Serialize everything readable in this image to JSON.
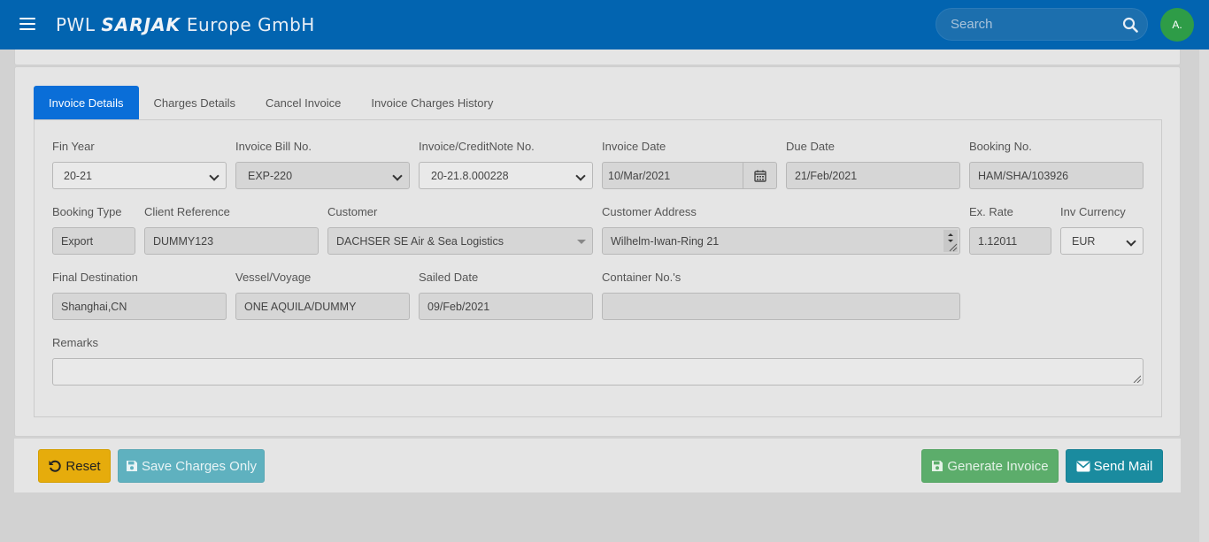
{
  "header": {
    "brand_prefix": "PWL",
    "brand_logo": "SARJAK",
    "brand_suffix": "Europe GmbH",
    "search_placeholder": "Search",
    "avatar_initials": "A.",
    "bar_color": "#0264b0"
  },
  "tabs": [
    {
      "label": "Invoice Details",
      "active": true
    },
    {
      "label": "Charges Details",
      "active": false
    },
    {
      "label": "Cancel Invoice",
      "active": false
    },
    {
      "label": "Invoice Charges History",
      "active": false
    }
  ],
  "form": {
    "fin_year": {
      "label": "Fin Year",
      "value": "20-21"
    },
    "invoice_bill_no": {
      "label": "Invoice Bill No.",
      "value": "EXP-220"
    },
    "invoice_credit_note_no": {
      "label": "Invoice/CreditNote No.",
      "value": "20-21.8.000228"
    },
    "invoice_date": {
      "label": "Invoice Date",
      "value": "10/Mar/2021"
    },
    "due_date": {
      "label": "Due Date",
      "value": "21/Feb/2021"
    },
    "booking_no": {
      "label": "Booking No.",
      "value": "HAM/SHA/103926"
    },
    "booking_type": {
      "label": "Booking Type",
      "value": "Export"
    },
    "client_reference": {
      "label": "Client Reference",
      "value": "DUMMY123"
    },
    "customer": {
      "label": "Customer",
      "value": "DACHSER SE Air & Sea Logistics"
    },
    "customer_address": {
      "label": "Customer Address",
      "value": "Wilhelm-Iwan-Ring 21"
    },
    "ex_rate": {
      "label": "Ex. Rate",
      "value": "1.12011"
    },
    "inv_currency": {
      "label": "Inv Currency",
      "value": "EUR"
    },
    "final_destination": {
      "label": "Final Destination",
      "value": "Shanghai,CN"
    },
    "vessel_voyage": {
      "label": "Vessel/Voyage",
      "value": "ONE AQUILA/DUMMY"
    },
    "sailed_date": {
      "label": "Sailed Date",
      "value": "09/Feb/2021"
    },
    "container_nos": {
      "label": "Container No.'s",
      "value": ""
    },
    "remarks": {
      "label": "Remarks",
      "value": ""
    }
  },
  "buttons": {
    "reset": "Reset",
    "save_charges_only": "Save Charges Only",
    "generate_invoice": "Generate Invoice",
    "send_mail": "Send Mail"
  },
  "icons": {
    "menu": "hamburger-icon",
    "search": "search-icon",
    "calendar": "calendar-icon",
    "reset": "undo-icon",
    "save": "floppy-icon",
    "mail": "envelope-icon"
  }
}
